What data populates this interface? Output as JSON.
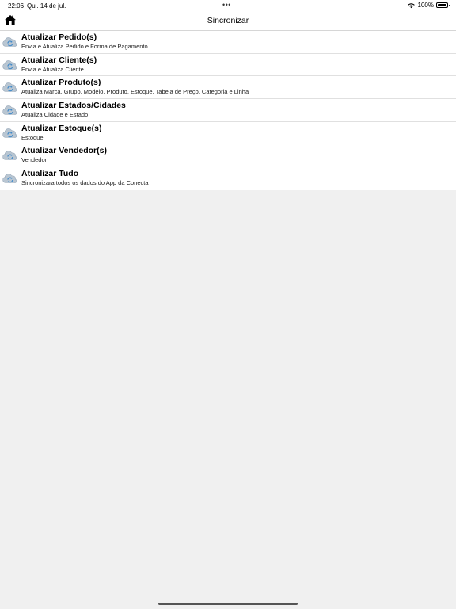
{
  "status_bar": {
    "time": "22:06",
    "date": "Qui. 14 de jul.",
    "multitask_dots": "•••",
    "battery": "100%"
  },
  "navbar": {
    "title": "Sincronizar",
    "home_icon": "home-icon"
  },
  "sync_items": [
    {
      "title": "Atualizar Pedido(s)",
      "subtitle": "Envia e Atualiza Pedido e Forma de Pagamento",
      "icon": "cloud-sync-icon"
    },
    {
      "title": "Atualizar Cliente(s)",
      "subtitle": "Envia e Atualiza Cliente",
      "icon": "cloud-sync-icon"
    },
    {
      "title": "Atualizar Produto(s)",
      "subtitle": "Atualiza Marca, Grupo, Modelo, Produto, Estoque, Tabela de Preço, Categoria e Linha",
      "icon": "cloud-sync-icon"
    },
    {
      "title": "Atualizar Estados/Cidades",
      "subtitle": "Atualiza Cidade e Estado",
      "icon": "cloud-sync-icon"
    },
    {
      "title": "Atualizar Estoque(s)",
      "subtitle": "Estoque",
      "icon": "cloud-sync-icon"
    },
    {
      "title": "Atualizar Vendedor(s)",
      "subtitle": "Vendedor",
      "icon": "cloud-sync-icon"
    },
    {
      "title": "Atualizar Tudo",
      "subtitle": "Sincronizara todos os dados do App da Conecta",
      "icon": "cloud-sync-icon"
    }
  ],
  "colors": {
    "background": "#f0f0f0",
    "cloud": "#b9c6d2",
    "sync_arrow": "#3a86c8"
  }
}
